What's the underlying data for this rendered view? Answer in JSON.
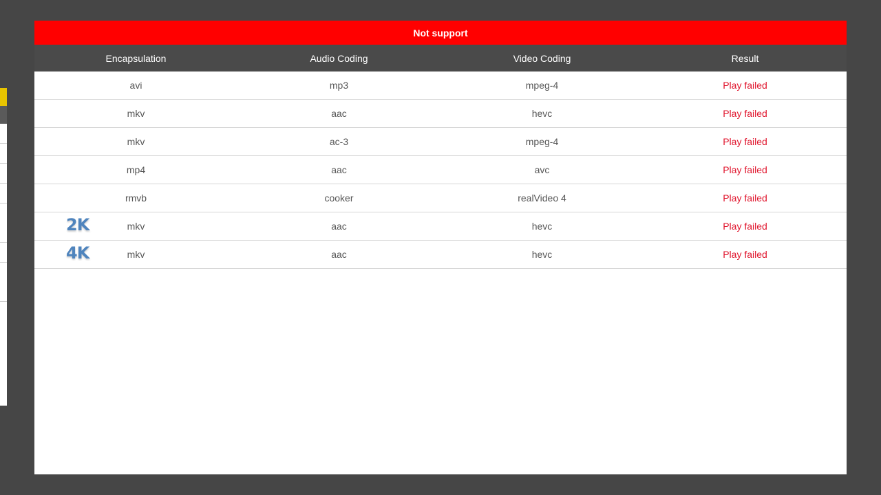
{
  "dialog": {
    "title": "Not support",
    "title_color": "#ff0000",
    "header_color": "#4a4a4a",
    "result_color": "#e0142c"
  },
  "table": {
    "headers": [
      "Encapsulation",
      "Audio Coding",
      "Video Coding",
      "Result"
    ],
    "rows": [
      {
        "badge": "",
        "encapsulation": "avi",
        "audio": "mp3",
        "video": "mpeg-4",
        "result": "Play failed"
      },
      {
        "badge": "",
        "encapsulation": "mkv",
        "audio": "aac",
        "video": "hevc",
        "result": "Play failed"
      },
      {
        "badge": "",
        "encapsulation": "mkv",
        "audio": "ac-3",
        "video": "mpeg-4",
        "result": "Play failed"
      },
      {
        "badge": "",
        "encapsulation": "mp4",
        "audio": "aac",
        "video": "avc",
        "result": "Play failed"
      },
      {
        "badge": "",
        "encapsulation": "rmvb",
        "audio": "cooker",
        "video": "realVideo 4",
        "result": "Play failed"
      },
      {
        "badge": "2K",
        "encapsulation": "mkv",
        "audio": "aac",
        "video": "hevc",
        "result": "Play failed"
      },
      {
        "badge": "4K",
        "encapsulation": "mkv",
        "audio": "aac",
        "video": "hevc",
        "result": "Play failed"
      }
    ]
  }
}
